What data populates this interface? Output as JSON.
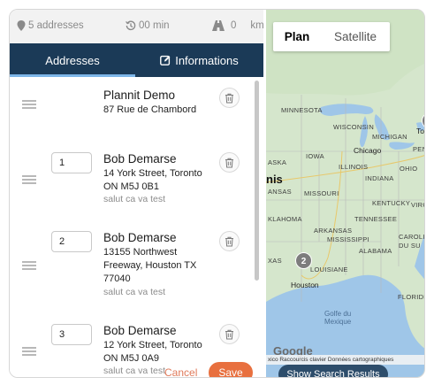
{
  "stats": {
    "addresses": "5 addresses",
    "duration": "00 min",
    "distance_value": "0",
    "distance_unit": "km"
  },
  "tabs": [
    {
      "label": "Addresses",
      "active": true
    },
    {
      "label": "Informations",
      "active": false
    }
  ],
  "stops": [
    {
      "order": "",
      "name": "Plannit Demo",
      "address": [
        "87 Rue de Chambord"
      ],
      "note": ""
    },
    {
      "order": "1",
      "name": "Bob Demarse",
      "address": [
        "14 York Street, Toronto",
        "ON M5J 0B1"
      ],
      "note": "salut ca va test"
    },
    {
      "order": "2",
      "name": "Bob Demarse",
      "address": [
        "13155 Northwest",
        "Freeway, Houston TX",
        "77040"
      ],
      "note": "salut ca va test"
    },
    {
      "order": "3",
      "name": "Bob Demarse",
      "address": [
        "12 York Street, Toronto",
        "ON M5J 0A9"
      ],
      "note": "salut ca va test"
    }
  ],
  "footer": {
    "cancel_label": "Cancel",
    "save_label": "Save"
  },
  "map": {
    "plan_label": "Plan",
    "satellite_label": "Satellite",
    "region_labels": [
      "MINNESOTA",
      "WISCONSIN",
      "MICHIGAN",
      "IOWA",
      "ILLINOIS",
      "OHIO",
      "INDIANA",
      "MISSOURI",
      "KENTUCKY",
      "TENNESSEE",
      "ARKANSAS",
      "MISSISSIPPI",
      "ALABAMA",
      "LOUISIANE",
      "KLAHOMA",
      "ASKA",
      "ANSAS",
      "XAS",
      "FLORIDE",
      "CAROLIN DU SU",
      "VIRGI",
      "PENN"
    ],
    "cities": [
      "Chicago",
      "Houston",
      "To",
      "nis"
    ],
    "sea_label": [
      "Golfe du",
      "Mexique"
    ],
    "google_label": "Google",
    "attribution": "xico  Raccourcis clavier   Données cartographiques",
    "markers": [
      "2"
    ],
    "show_results_label": "Show Search Results",
    "colors": {
      "land": "#d5e6cc",
      "water": "#9fc6e8",
      "marker": "#7d7d7d"
    }
  },
  "colors": {
    "header_bg": "#1b3a57",
    "accent": "#e8703f",
    "tab_underline": "#7db6e8"
  }
}
